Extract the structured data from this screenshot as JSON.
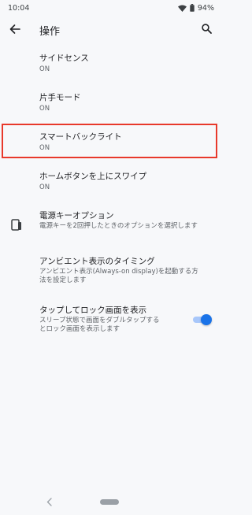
{
  "status": {
    "time": "10:04",
    "battery": "94%"
  },
  "appbar": {
    "title": "操作",
    "back_icon": "arrow-left-icon",
    "search_icon": "search-icon"
  },
  "items": [
    {
      "title": "サイドセンス",
      "sub": "ON"
    },
    {
      "title": "片手モード",
      "sub": "ON"
    },
    {
      "title": "スマートバックライト",
      "sub": "ON"
    },
    {
      "title": "ホームボタンを上にスワイプ",
      "sub": "ON"
    },
    {
      "title": "電源キーオプション",
      "sub": "電源キーを2回押したときのオプションを選択します"
    },
    {
      "title": "アンビエント表示のタイミング",
      "sub1": "アンビエント表示(Always-on display)を起動する方",
      "sub2": "法を設定します"
    },
    {
      "title": "タップしてロック画面を表示",
      "sub1": "スリープ状態で画面をダブルタップする",
      "sub2": "とロック画面を表示します",
      "toggle_on": true
    }
  ],
  "colors": {
    "accent": "#1a73e8",
    "highlight": "#e8392b"
  }
}
